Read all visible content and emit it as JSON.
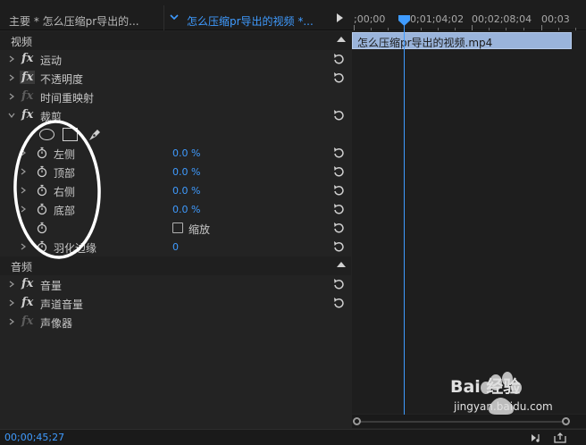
{
  "header": {
    "master_tab": "主要 * 怎么压缩pr导出的...",
    "active_clip_tab": "怎么压缩pr导出的视频 *..."
  },
  "timeline": {
    "timecodes": [
      ";00;00",
      "00;01;04;02",
      "00;02;08;04",
      "00;03"
    ],
    "clip_name": "怎么压缩pr导出的视频.mp4",
    "playhead_color": "#3f9bff"
  },
  "sections": {
    "video": "视频",
    "audio": "音频"
  },
  "video_effects": {
    "motion": "运动",
    "opacity": "不透明度",
    "time_remap": "时间重映射",
    "crop": "裁剪"
  },
  "crop": {
    "left_label": "左侧",
    "left_value": "0.0 %",
    "top_label": "顶部",
    "top_value": "0.0 %",
    "right_label": "右侧",
    "right_value": "0.0 %",
    "bottom_label": "底部",
    "bottom_value": "0.0 %",
    "zoom_label": "缩放",
    "feather_label": "羽化边缘",
    "feather_value": "0"
  },
  "audio_effects": {
    "volume": "音量",
    "channel_volume": "声道音量",
    "panner": "声像器"
  },
  "footer": {
    "current_timecode": "00;00;45;27"
  },
  "watermark": {
    "brand": "Bai  经验",
    "url": "jingyan.baidu.com"
  },
  "colors": {
    "accent": "#3f9bff",
    "panel_bg": "#232323",
    "clip_fill": "#9ab4db"
  }
}
